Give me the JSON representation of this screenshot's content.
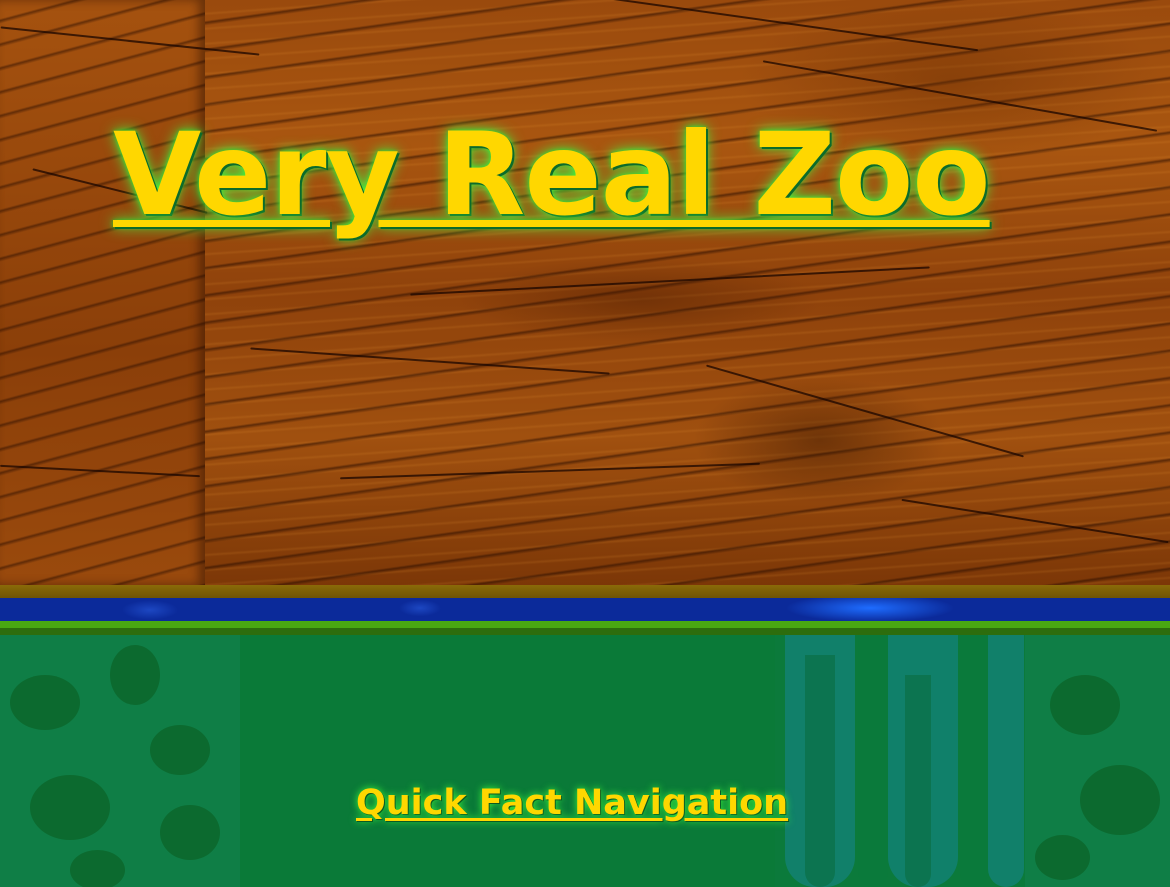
{
  "header": {
    "title": "Very Real Zoo"
  },
  "navigation": {
    "quick_fact_link": "Quick Fact Navigation"
  },
  "colors": {
    "title_text": "#ffd700",
    "title_glow": "#44ff44",
    "band_gold": "#8a6a08",
    "band_blue": "#0b2a9a",
    "band_green": "#49a812",
    "jungle_green": "#0b7a3b"
  }
}
